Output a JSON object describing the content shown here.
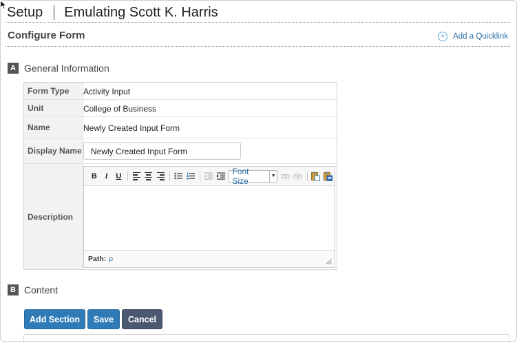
{
  "header": {
    "app_title": "Setup",
    "emulating": "Emulating Scott K. Harris"
  },
  "page": {
    "title": "Configure Form",
    "quicklink_label": "Add a Quicklink"
  },
  "sections": [
    {
      "letter": "A",
      "title": "General Information"
    },
    {
      "letter": "B",
      "title": "Content"
    }
  ],
  "form": {
    "form_type": {
      "label": "Form Type",
      "value": "Activity Input"
    },
    "unit": {
      "label": "Unit",
      "value": "College of Business"
    },
    "name": {
      "label": "Name",
      "value": "Newly Created Input Form"
    },
    "display_name": {
      "label": "Display Name",
      "value": "Newly Created Input Form"
    },
    "description": {
      "label": "Description"
    }
  },
  "editor": {
    "bold": "B",
    "italic": "I",
    "underline": "U",
    "font_size": "Font Size",
    "path_label": "Path:",
    "path_value": "p"
  },
  "buttons": {
    "add_section": "Add Section",
    "save": "Save",
    "cancel": "Cancel"
  },
  "colors": {
    "primary": "#2f7bb7",
    "cancel": "#4a5870",
    "link": "#2a6fa8"
  }
}
